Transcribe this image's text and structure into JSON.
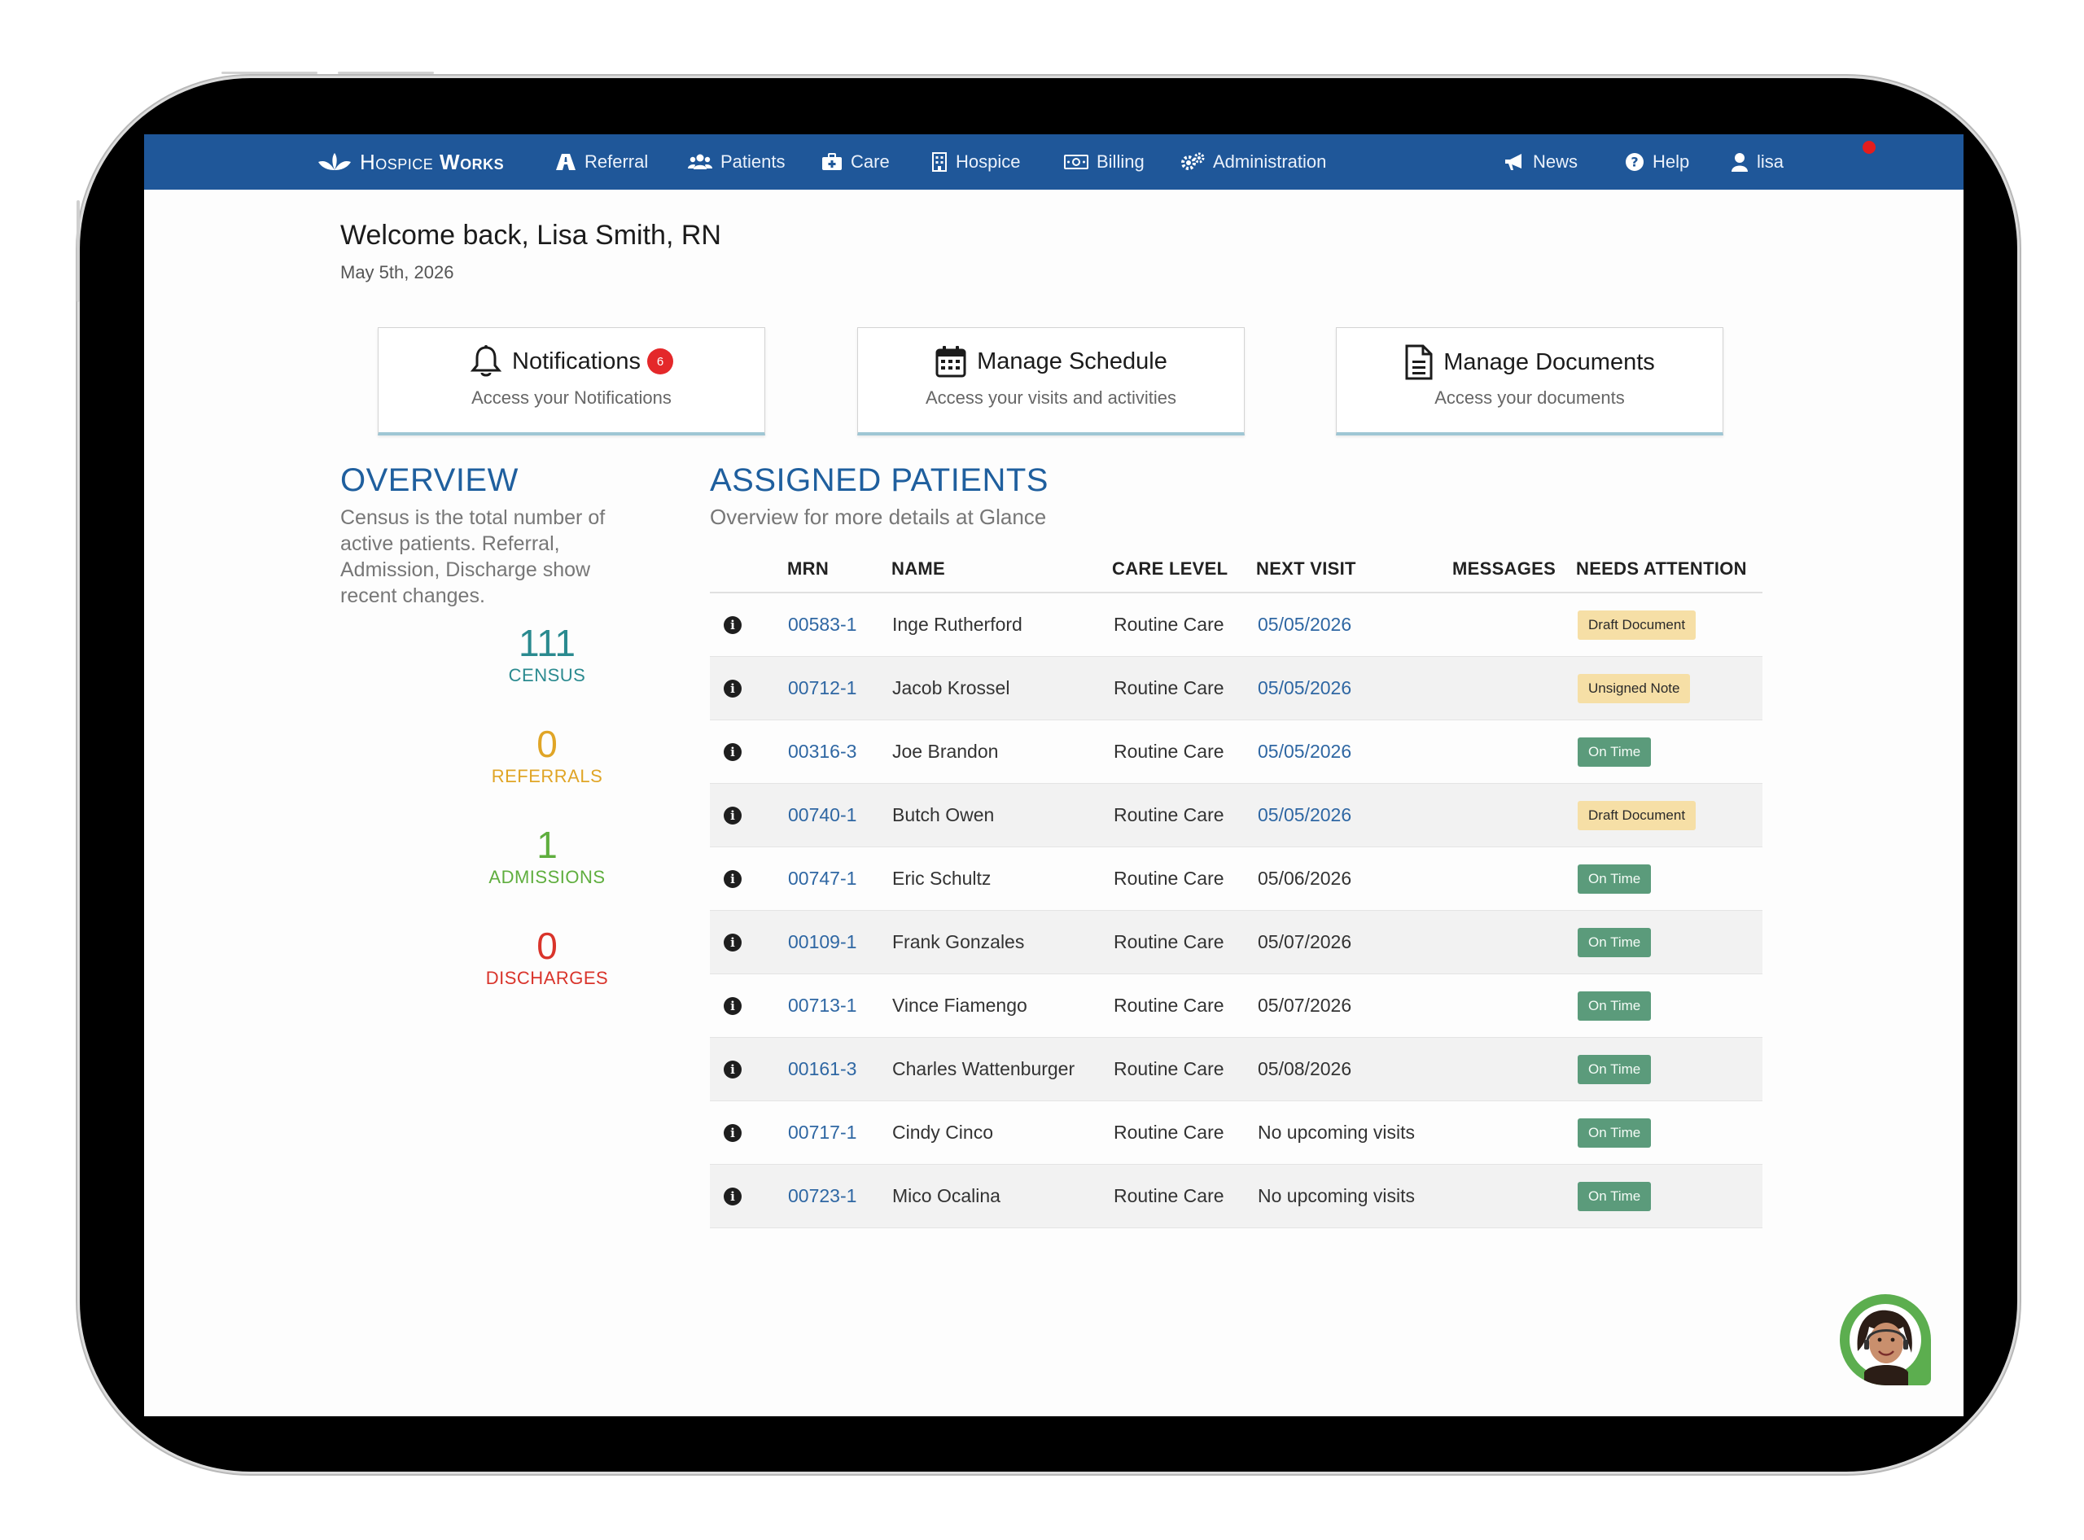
{
  "nav": {
    "logo_prefix": "Hospice",
    "logo_suffix": "Works",
    "items": [
      {
        "label": "Referral",
        "icon": "road-icon"
      },
      {
        "label": "Patients",
        "icon": "users-icon"
      },
      {
        "label": "Care",
        "icon": "medkit-icon"
      },
      {
        "label": "Hospice",
        "icon": "building-icon"
      },
      {
        "label": "Billing",
        "icon": "money-icon"
      },
      {
        "label": "Administration",
        "icon": "gears-icon"
      }
    ],
    "news": "News",
    "help": "Help",
    "user": "lisa"
  },
  "header": {
    "welcome": "Welcome back, Lisa Smith, RN",
    "date": "May 5th, 2026"
  },
  "cards": {
    "notifications": {
      "title": "Notifications",
      "count": "6",
      "subtitle": "Access your Notifications"
    },
    "schedule": {
      "title": "Manage Schedule",
      "subtitle": "Access your visits and activities"
    },
    "documents": {
      "title": "Manage Documents",
      "subtitle": "Access your documents"
    }
  },
  "overview": {
    "title": "OVERVIEW",
    "description": "Census is the total number of active patients. Referral, Admission, Discharge show recent changes.",
    "stats": [
      {
        "value": "111",
        "label": "CENSUS",
        "color": "#2a8a8f"
      },
      {
        "value": "0",
        "label": "REFERRALS",
        "color": "#e0a526"
      },
      {
        "value": "1",
        "label": "ADMISSIONS",
        "color": "#5fae3e"
      },
      {
        "value": "0",
        "label": "DISCHARGES",
        "color": "#d9342b"
      }
    ]
  },
  "assigned": {
    "title": "ASSIGNED PATIENTS",
    "subtitle": "Overview for more details at Glance",
    "columns": [
      "MRN",
      "NAME",
      "CARE LEVEL",
      "NEXT VISIT",
      "MESSAGES",
      "NEEDS ATTENTION"
    ],
    "rows": [
      {
        "mrn": "00583-1",
        "name": "Inge Rutherford",
        "care": "Routine Care",
        "visit": "05/05/2026",
        "visit_link": true,
        "messages": "",
        "attention": "Draft Document",
        "status": "draft"
      },
      {
        "mrn": "00712-1",
        "name": "Jacob Krossel",
        "care": "Routine Care",
        "visit": "05/05/2026",
        "visit_link": true,
        "messages": "",
        "attention": "Unsigned Note",
        "status": "draft"
      },
      {
        "mrn": "00316-3",
        "name": "Joe Brandon",
        "care": "Routine Care",
        "visit": "05/05/2026",
        "visit_link": true,
        "messages": "",
        "attention": "On Time",
        "status": "ontime"
      },
      {
        "mrn": "00740-1",
        "name": "Butch Owen",
        "care": "Routine Care",
        "visit": "05/05/2026",
        "visit_link": true,
        "messages": "",
        "attention": "Draft Document",
        "status": "draft"
      },
      {
        "mrn": "00747-1",
        "name": "Eric Schultz",
        "care": "Routine Care",
        "visit": "05/06/2026",
        "visit_link": false,
        "messages": "",
        "attention": "On Time",
        "status": "ontime"
      },
      {
        "mrn": "00109-1",
        "name": "Frank Gonzales",
        "care": "Routine Care",
        "visit": "05/07/2026",
        "visit_link": false,
        "messages": "",
        "attention": "On Time",
        "status": "ontime"
      },
      {
        "mrn": "00713-1",
        "name": "Vince Fiamengo",
        "care": "Routine Care",
        "visit": "05/07/2026",
        "visit_link": false,
        "messages": "",
        "attention": "On Time",
        "status": "ontime"
      },
      {
        "mrn": "00161-3",
        "name": "Charles Wattenburger",
        "care": "Routine Care",
        "visit": "05/08/2026",
        "visit_link": false,
        "messages": "",
        "attention": "On Time",
        "status": "ontime"
      },
      {
        "mrn": "00717-1",
        "name": "Cindy Cinco",
        "care": "Routine Care",
        "visit": "No upcoming visits",
        "visit_link": false,
        "messages": "",
        "attention": "On Time",
        "status": "ontime"
      },
      {
        "mrn": "00723-1",
        "name": "Mico Ocalina",
        "care": "Routine Care",
        "visit": "No upcoming visits",
        "visit_link": false,
        "messages": "",
        "attention": "On Time",
        "status": "ontime"
      }
    ]
  },
  "colors": {
    "nav_bg": "#1f5799",
    "accent_blue": "#1f5f9e",
    "link": "#2f67a3",
    "badge_red": "#e4282a",
    "tag_draft": "#f6dfa6",
    "tag_ontime": "#5b9b7b"
  }
}
